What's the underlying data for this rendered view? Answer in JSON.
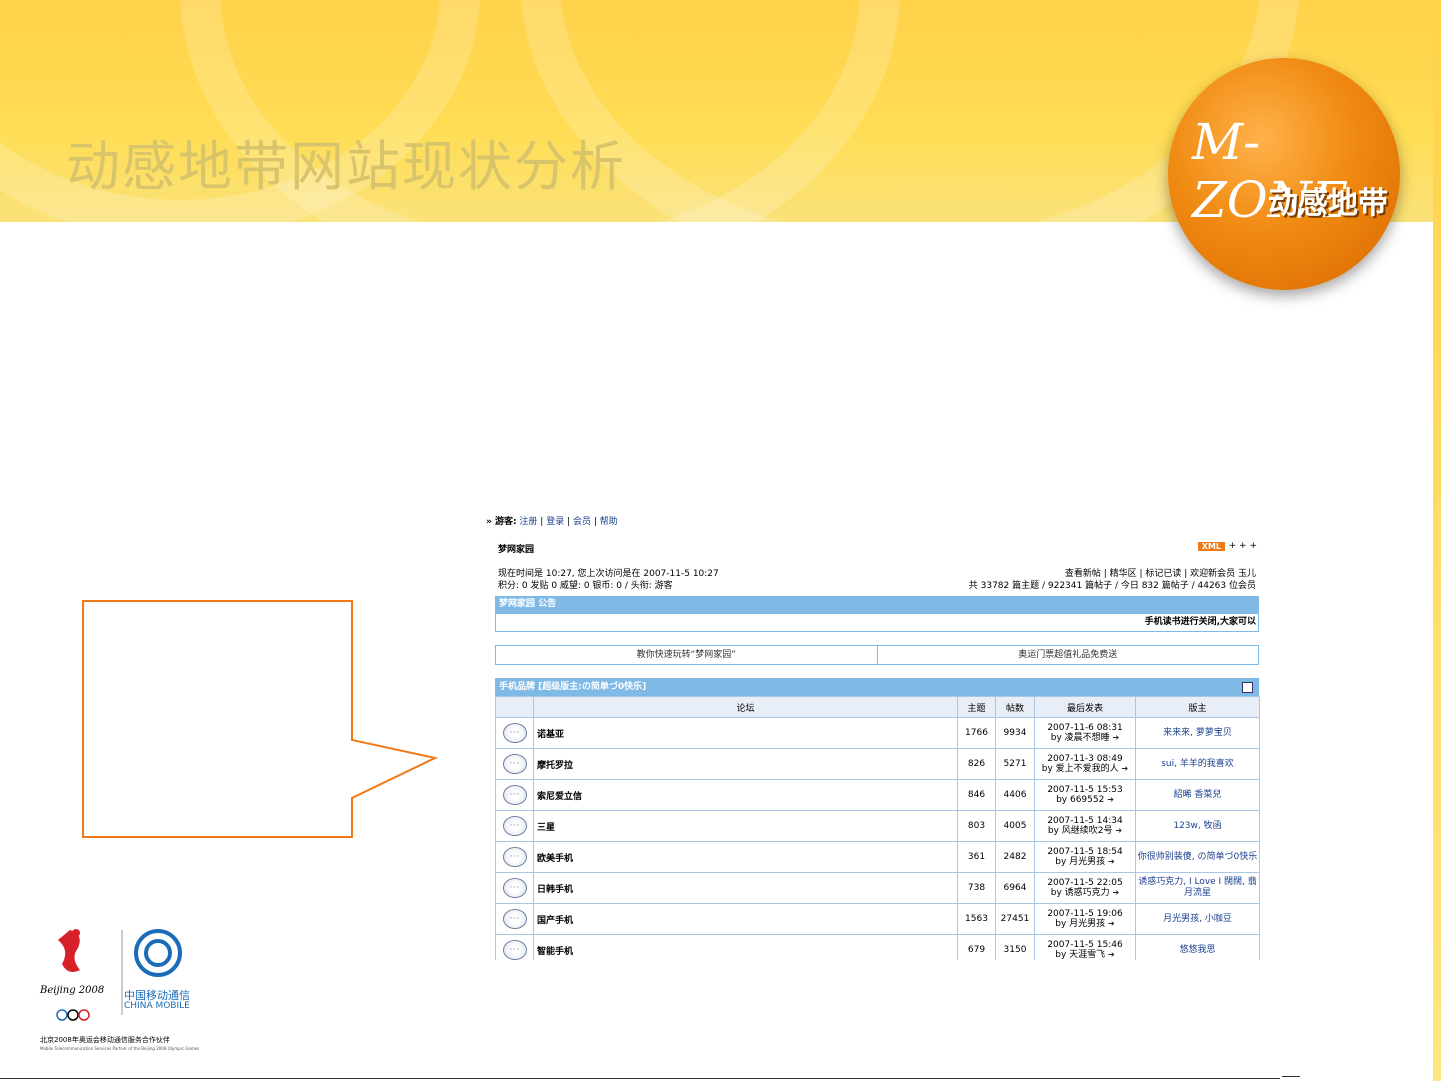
{
  "slide": {
    "title": "动感地带网站现状分析",
    "logo_text": "M-ZONE",
    "logo_cn": "动感地带",
    "olympic_label": "Beijing 2008",
    "china_mobile_cn": "中国移动通信",
    "china_mobile_en": "CHINA MOBILE",
    "partner_text": "北京2008年奥运会移动通信服务合作伙伴",
    "partner_subtext": "Mobile Telecommunication Services Partner of the Beijing 2008 Olympic Games",
    "colors": {
      "header_yellow": "#ffd24a",
      "accent_orange": "#f07a1a",
      "forum_blue": "#7fb9e6"
    }
  },
  "forum": {
    "top_nav": {
      "prefix": "» 游客:",
      "links": [
        "注册",
        "登录",
        "会员",
        "帮助"
      ]
    },
    "site_name": "梦网家园",
    "xml_badge": "XML",
    "info_left_1": "现在时间是 10:27, 您上次访问是在 2007-11-5 10:27",
    "info_left_2": "积分: 0 发贴 0 威望: 0 银币: 0 / 头衔: 游客",
    "info_right_1": "查看新帖 | 精华区 | 标记已读 | 欢迎新会员 玉儿",
    "info_right_2": "共 33782 篇主题 / 922341 篇帖子 / 今日 832 篇帖子 / 44263 位会员",
    "notice_title": "梦网家园 公告",
    "notice_text": "手机读书进行关闭,大家可以",
    "promo_left": "教你快速玩转“梦网家园”",
    "promo_right": "奥运门票超值礼品免费送",
    "category_title": "手机品牌 [超级版主:の简单づ0快乐]",
    "columns": [
      "论坛",
      "主题",
      "帖数",
      "最后发表",
      "版主"
    ],
    "rows": [
      {
        "name": "诺基亚",
        "topics": "1766",
        "posts": "9934",
        "last_time": "2007-11-6 08:31",
        "last_by": "by 凌晨不想睡",
        "mods": "来来来, 萝萝宝贝"
      },
      {
        "name": "摩托罗拉",
        "topics": "826",
        "posts": "5271",
        "last_time": "2007-11-3 08:49",
        "last_by": "by 爱上不爱我的人",
        "mods": "sui, 羊羊的我喜欢"
      },
      {
        "name": "索尼爱立信",
        "topics": "846",
        "posts": "4406",
        "last_time": "2007-11-5 15:53",
        "last_by": "by 669552",
        "mods": "紹晞 香菜兒"
      },
      {
        "name": "三星",
        "topics": "803",
        "posts": "4005",
        "last_time": "2007-11-5 14:34",
        "last_by": "by 风继续吹2号",
        "mods": "123w, 牧函"
      },
      {
        "name": "欧美手机",
        "topics": "361",
        "posts": "2482",
        "last_time": "2007-11-5 18:54",
        "last_by": "by 月光男孩",
        "mods": "你很帅别装傻, の简单づ0快乐"
      },
      {
        "name": "日韩手机",
        "topics": "738",
        "posts": "6964",
        "last_time": "2007-11-5 22:05",
        "last_by": "by 诱惑巧克力",
        "mods": "诱惑巧克力, I Love I 闊闊, 翡月流星"
      },
      {
        "name": "国产手机",
        "topics": "1563",
        "posts": "27451",
        "last_time": "2007-11-5 19:06",
        "last_by": "by 月光男孩",
        "mods": "月光男孩, 小咖豆"
      },
      {
        "name": "智能手机",
        "topics": "679",
        "posts": "3150",
        "last_time": "2007-11-5 15:46",
        "last_by": "by 天涯雪飞",
        "mods": "悠悠我思"
      }
    ]
  }
}
